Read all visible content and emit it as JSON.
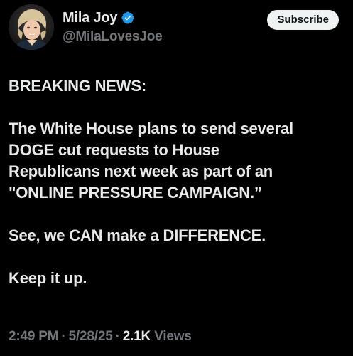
{
  "author": {
    "display_name": "Mila Joy",
    "handle": "@MilaLovesJoe",
    "verified": true,
    "avatar_icon": "user-avatar"
  },
  "actions": {
    "subscribe_label": "Subscribe"
  },
  "tweet": {
    "paragraphs": [
      "BREAKING NEWS:",
      "The White House plans to send several\nDOGE cut requests to House\nRepublicans next week as part of an\n\"ONLINE PRESSURE CAMPAIGN.”",
      "See, we CAN make a DIFFERENCE.",
      "Keep it up."
    ]
  },
  "meta": {
    "time": "2:49 PM",
    "date": "5/28/25",
    "views_count": "2.1K",
    "views_label": "Views",
    "separator": "·"
  },
  "colors": {
    "background": "#000000",
    "text": "#e7e9ea",
    "muted": "#71767b",
    "verified": "#1d9bf0",
    "button_bg": "#eff3f4"
  }
}
